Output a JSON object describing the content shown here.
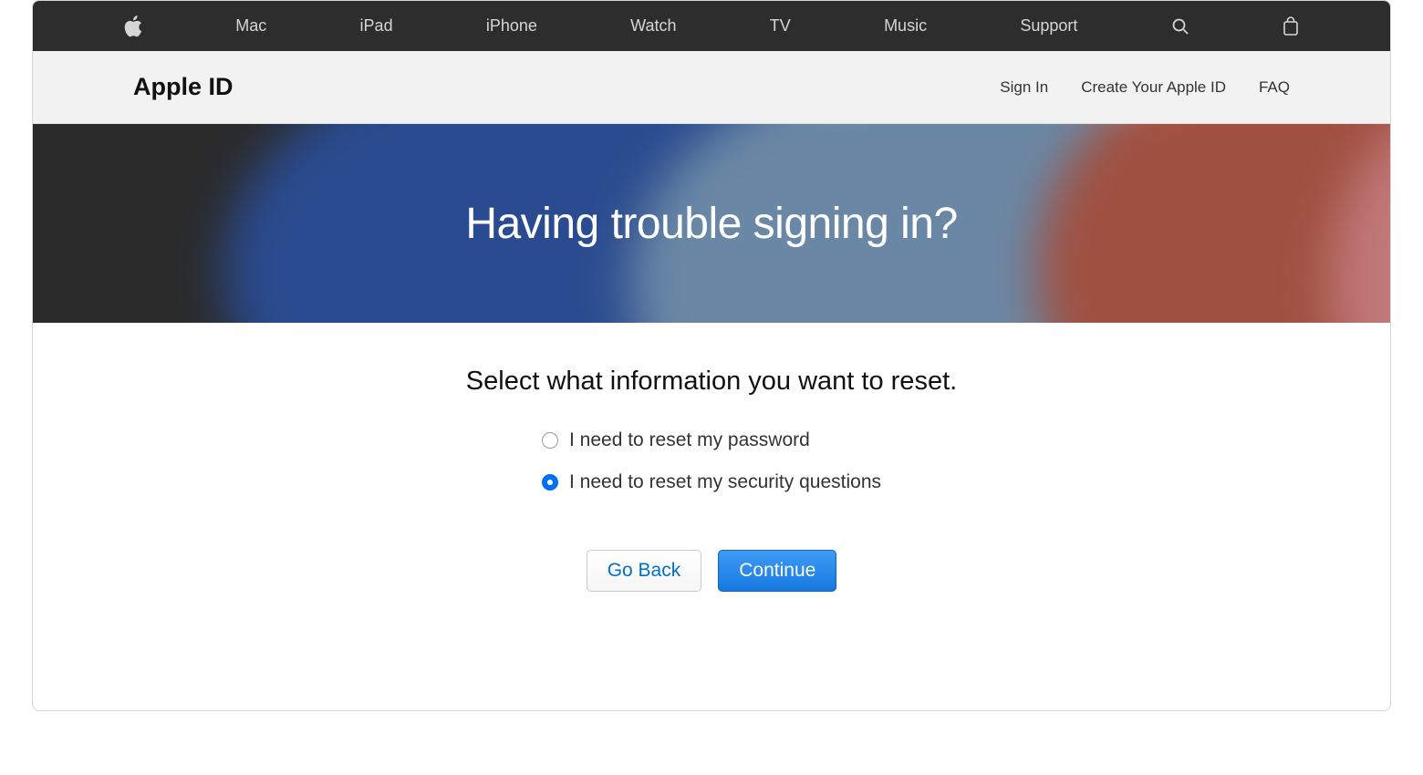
{
  "globalNav": {
    "items": [
      "Mac",
      "iPad",
      "iPhone",
      "Watch",
      "TV",
      "Music",
      "Support"
    ],
    "icons": {
      "logo": "apple-logo-icon",
      "search": "search-icon",
      "bag": "bag-icon"
    }
  },
  "subNav": {
    "brand": "Apple ID",
    "links": [
      "Sign In",
      "Create Your Apple ID",
      "FAQ"
    ]
  },
  "hero": {
    "title": "Having trouble signing in?"
  },
  "form": {
    "heading": "Select what information you want to reset.",
    "options": [
      {
        "label": "I need to reset my password",
        "selected": false
      },
      {
        "label": "I need to reset my security questions",
        "selected": true
      }
    ],
    "buttons": {
      "back": "Go Back",
      "continue": "Continue"
    }
  }
}
